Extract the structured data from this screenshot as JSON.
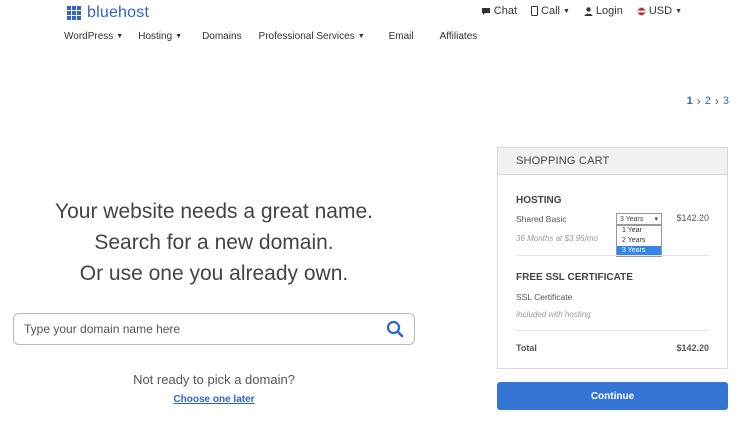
{
  "brand": {
    "name": "bluehost",
    "color": "#2f65c8"
  },
  "topnav": {
    "chat": "Chat",
    "call": "Call",
    "login": "Login",
    "currency": "USD"
  },
  "mainnav": [
    {
      "label": "WordPress",
      "dropdown": true
    },
    {
      "label": "Hosting",
      "dropdown": true
    },
    {
      "label": "Domains",
      "dropdown": false
    },
    {
      "label": "Professional Services",
      "dropdown": true
    },
    {
      "label": "Email",
      "dropdown": false
    },
    {
      "label": "Affiliates",
      "dropdown": false
    }
  ],
  "pager": {
    "steps": [
      "1",
      "2",
      "3"
    ],
    "current": "1"
  },
  "hero": {
    "line1": "Your website needs a great name.",
    "line2": "Search for a new domain.",
    "line3": "Or use one you already own."
  },
  "search": {
    "placeholder": "Type your domain name here",
    "value": ""
  },
  "alt": {
    "question": "Not ready to pick a domain?",
    "link": "Choose one later"
  },
  "cart": {
    "title": "SHOPPING CART",
    "hosting": {
      "title": "HOSTING",
      "plan": "Shared Basic",
      "price": "$142.20",
      "term_note": "36 Months at $3.95/mo",
      "term_selected": "3 Years",
      "term_options": [
        "1 Year",
        "2 Years",
        "3 Years"
      ]
    },
    "ssl": {
      "title": "FREE SSL CERTIFICATE",
      "item": "SSL Certificate",
      "note": "Included with hosting"
    },
    "total_label": "Total",
    "total_price": "$142.20"
  },
  "continue_label": "Continue"
}
